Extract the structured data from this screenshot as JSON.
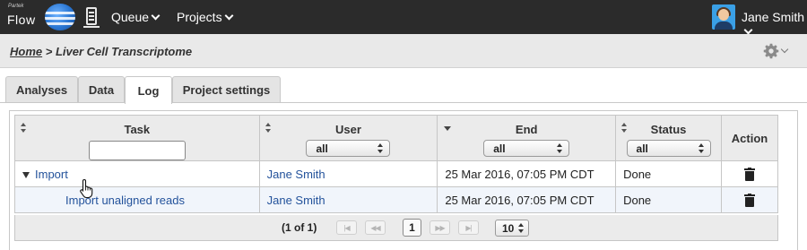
{
  "app": {
    "logo_small": "Partek",
    "logo_text": "Flow",
    "nav": {
      "queue": "Queue",
      "projects": "Projects"
    },
    "user": "Jane Smith"
  },
  "breadcrumb": {
    "home": "Home",
    "separator": " > ",
    "project": "Liver Cell Transcriptome"
  },
  "tabs": [
    {
      "label": "Analyses",
      "active": false
    },
    {
      "label": "Data",
      "active": false
    },
    {
      "label": "Log",
      "active": true
    },
    {
      "label": "Project settings",
      "active": false
    }
  ],
  "table": {
    "columns": {
      "task": "Task",
      "user": "User",
      "end": "End",
      "status": "Status",
      "action": "Action"
    },
    "filters": {
      "task_value": "",
      "user": "all",
      "end": "all",
      "status": "all"
    },
    "rows": [
      {
        "task": "Import",
        "user": "Jane Smith",
        "end": "25 Mar 2016, 07:05 PM CDT",
        "status": "Done",
        "expanded": true
      },
      {
        "task": "Import unaligned reads",
        "user": "Jane Smith",
        "end": "25 Mar 2016, 07:05 PM CDT",
        "status": "Done",
        "child": true
      }
    ]
  },
  "pager": {
    "info": "(1 of 1)",
    "current_page": "1",
    "page_size": "10",
    "first": "|◀",
    "prev": "◀◀",
    "next": "▶▶",
    "last": "▶|"
  },
  "colors": {
    "topbar": "#2b2b2b",
    "link": "#23529b",
    "header_bg": "#ebebeb",
    "child_row_bg": "#f1f5fb"
  },
  "icons": {
    "logo": "partek-flow-wave-logo",
    "server": "server-icon",
    "avatar": "user-avatar",
    "settings": "gear-icon",
    "delete": "trash-icon",
    "cursor": "hand-pointer-icon"
  }
}
